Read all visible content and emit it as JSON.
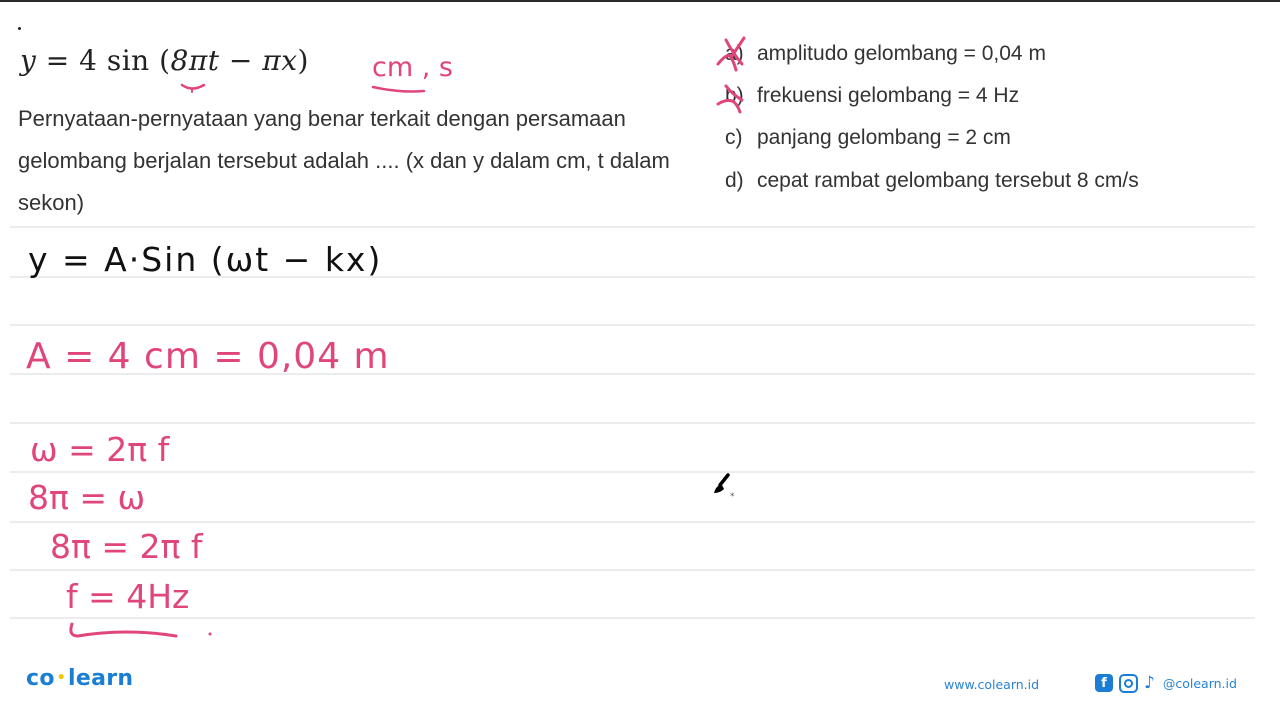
{
  "problem": {
    "equation": {
      "lhs": "y",
      "equals": "=",
      "coefficient": "4",
      "func": "sin",
      "open": "(",
      "term1": "8πt",
      "minus": "−",
      "term2": "πx",
      "close": ")"
    },
    "units_annotation": "cm , s",
    "question": "Pernyataan-pernyataan yang benar terkait dengan persamaan gelombang berjalan tersebut adalah .... (x dan y dalam cm, t dalam sekon)",
    "options": [
      {
        "label": "a)",
        "text": "amplitudo gelombang = 0,04 m",
        "marked": true
      },
      {
        "label": "b)",
        "text": "frekuensi gelombang = 4 Hz",
        "marked": true
      },
      {
        "label": "c)",
        "text": "panjang gelombang = 2 cm",
        "marked": false
      },
      {
        "label": "d)",
        "text": "cepat rambat gelombang tersebut 8 cm/s",
        "marked": false
      }
    ]
  },
  "handwriting": {
    "general_formula": "y = A·Sin (ωt − kx)",
    "amplitude": "A = 4 cm = 0,04 m",
    "omega_def": "ω = 2π f",
    "omega_value": "8π = ω",
    "solve": "8π = 2π f",
    "result": "f = 4Hz"
  },
  "colors": {
    "ink_pink": "#e0457b",
    "ink_black": "#111111",
    "brand_blue": "#1a7fd4",
    "brand_yellow": "#f2c500"
  },
  "footer": {
    "logo_left": "co",
    "logo_sep": "•",
    "logo_right": "learn",
    "website": "www.colearn.id",
    "social_handle": "@colearn.id",
    "icons": [
      "facebook-icon",
      "instagram-icon",
      "tiktok-icon"
    ]
  }
}
